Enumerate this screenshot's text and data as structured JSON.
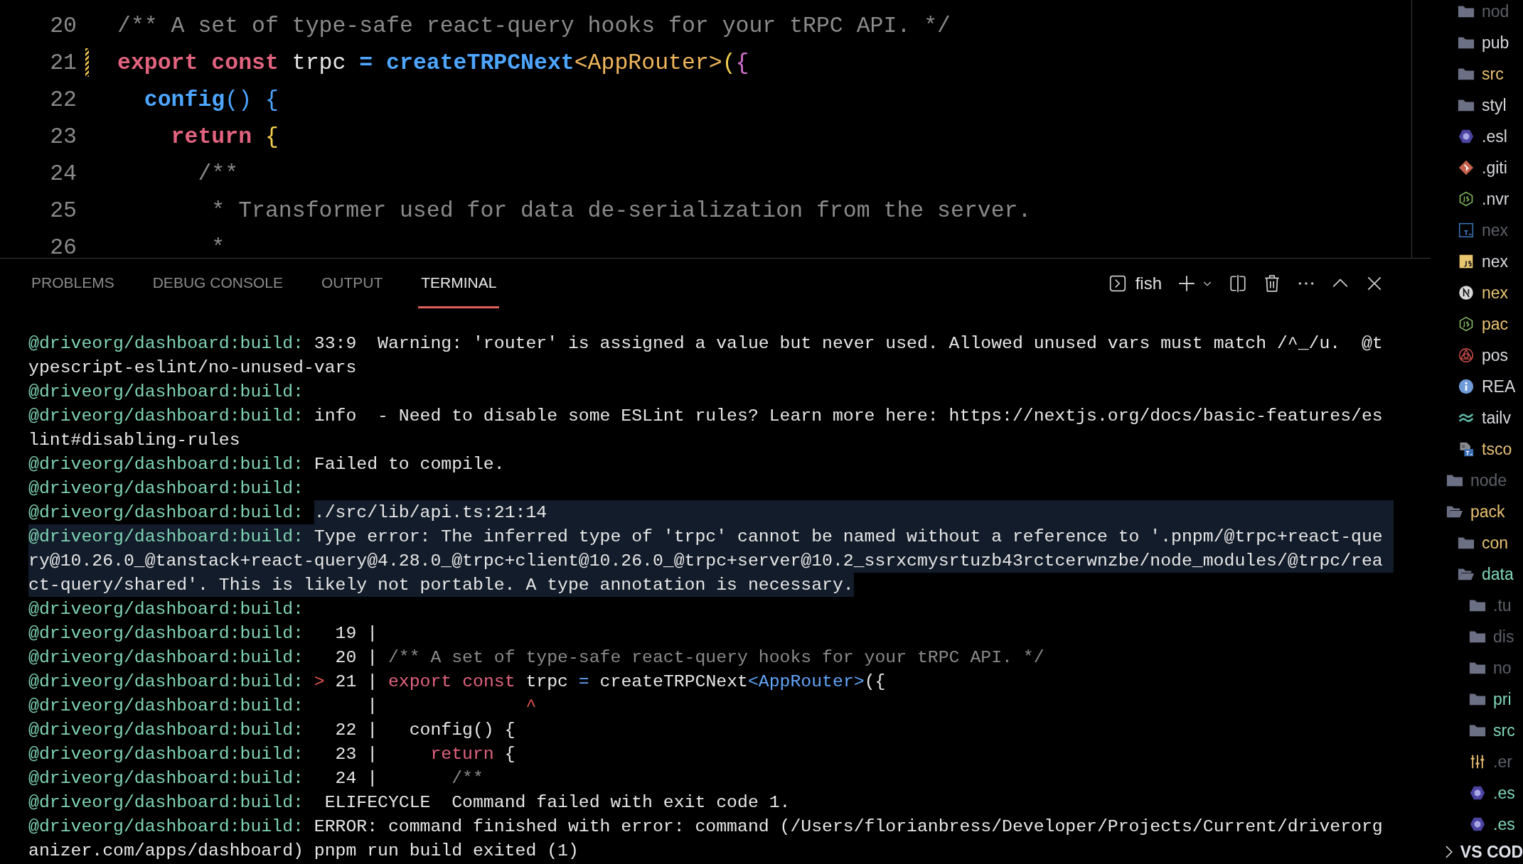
{
  "editor": {
    "lines": [
      {
        "number": "20",
        "modified": false,
        "tokens": [
          {
            "text": "/** A set of type-safe react-query hooks for your tRPC API. */",
            "kind": "comment"
          }
        ]
      },
      {
        "number": "21",
        "modified": true,
        "tokens": [
          {
            "text": "export const",
            "kind": "keyword"
          },
          {
            "text": " trpc ",
            "kind": "plain"
          },
          {
            "text": "=",
            "kind": "function"
          },
          {
            "text": " createTRPCNext",
            "kind": "function"
          },
          {
            "text": "<AppRouter>",
            "kind": "type"
          },
          {
            "text": "(",
            "kind": "bracket"
          },
          {
            "text": "{",
            "kind": "bracket2"
          }
        ]
      },
      {
        "number": "22",
        "modified": false,
        "tokens": [
          {
            "text": "  config",
            "kind": "function"
          },
          {
            "text": "() {",
            "kind": "bracket3"
          }
        ]
      },
      {
        "number": "23",
        "modified": false,
        "tokens": [
          {
            "text": "    return",
            "kind": "keyword"
          },
          {
            "text": " {",
            "kind": "bracket"
          }
        ]
      },
      {
        "number": "24",
        "modified": false,
        "tokens": [
          {
            "text": "      /**",
            "kind": "comment"
          }
        ]
      },
      {
        "number": "25",
        "modified": false,
        "tokens": [
          {
            "text": "       * Transformer used for data de-serialization from the server.",
            "kind": "comment"
          }
        ]
      },
      {
        "number": "26",
        "modified": false,
        "tokens": [
          {
            "text": "       *",
            "kind": "comment"
          }
        ]
      }
    ]
  },
  "panel": {
    "tabs": [
      {
        "label": "PROBLEMS",
        "selected": false
      },
      {
        "label": "DEBUG CONSOLE",
        "selected": false
      },
      {
        "label": "OUTPUT",
        "selected": false
      },
      {
        "label": "TERMINAL",
        "selected": true
      }
    ],
    "shell": "fish",
    "rows": [
      {
        "prefix": "@driveorg/dashboard:build:",
        "selected": false,
        "segments": [
          {
            "text": "33:9  Warning: 'router' is assigned a value but never used. Allowed unused vars must match /^_/u.  @t",
            "kind": "plain"
          }
        ]
      },
      {
        "selected": false,
        "segments": [
          {
            "text": "ypescript-eslint/no-unused-vars",
            "kind": "plain"
          }
        ]
      },
      {
        "prefix": "@driveorg/dashboard:build:",
        "selected": false
      },
      {
        "prefix": "@driveorg/dashboard:build:",
        "selected": false,
        "segments": [
          {
            "text": "info  - Need to disable some ESLint rules? Learn more here: https://nextjs.org/docs/basic-features/es",
            "kind": "plain"
          }
        ]
      },
      {
        "selected": false,
        "segments": [
          {
            "text": "lint#disabling-rules",
            "kind": "plain"
          }
        ]
      },
      {
        "prefix": "@driveorg/dashboard:build:",
        "selected": false,
        "segments": [
          {
            "text": "Failed to compile.",
            "kind": "plain"
          }
        ]
      },
      {
        "prefix": "@driveorg/dashboard:build:",
        "selected": false
      },
      {
        "prefix": "@driveorg/dashboard:build:",
        "selected": true,
        "segments": [
          {
            "text": "./src/lib/api.ts:21:14",
            "kind": "plain"
          }
        ]
      },
      {
        "prefix": "@driveorg/dashboard:build:",
        "selected": true,
        "segments": [
          {
            "text": "Type error: The inferred type of 'trpc' cannot be named without a reference to '.pnpm/@trpc+react-que",
            "kind": "plain"
          }
        ]
      },
      {
        "selected": true,
        "segments": [
          {
            "text": "ry@10.26.0_@tanstack+react-query@4.28.0_@trpc+client@10.26.0_@trpc+server@10.2_ssrxcmysrtuzb43rctcerwnzbe/node_modules/@trpc/rea",
            "kind": "plain"
          }
        ]
      },
      {
        "selected": true,
        "segments": [
          {
            "text": "ct-query/shared'. This is likely not portable. A type annotation is necessary.",
            "kind": "plain"
          }
        ]
      },
      {
        "prefix": "@driveorg/dashboard:build:",
        "selected": false
      },
      {
        "prefix": "@driveorg/dashboard:build:",
        "selected": false,
        "segments": [
          {
            "text": "  19 |",
            "kind": "plain"
          }
        ]
      },
      {
        "prefix": "@driveorg/dashboard:build:",
        "selected": false,
        "segments": [
          {
            "text": "  20 | ",
            "kind": "plain"
          },
          {
            "text": "/** A set of type-safe react-query hooks for your tRPC API. */",
            "kind": "comment"
          }
        ]
      },
      {
        "prefix": "@driveorg/dashboard:build:",
        "selected": false,
        "segments": [
          {
            "text": ">",
            "kind": "marker"
          },
          {
            "text": " 21 | ",
            "kind": "plain"
          },
          {
            "text": "export const",
            "kind": "keyword"
          },
          {
            "text": " trpc ",
            "kind": "plain"
          },
          {
            "text": "=",
            "kind": "operator"
          },
          {
            "text": " createTRPCNext",
            "kind": "plain"
          },
          {
            "text": "<AppRouter>",
            "kind": "operator"
          },
          {
            "text": "({",
            "kind": "plain"
          }
        ]
      },
      {
        "prefix": "@driveorg/dashboard:build:",
        "selected": false,
        "segments": [
          {
            "text": "     |              ",
            "kind": "plain"
          },
          {
            "text": "^",
            "kind": "marker"
          }
        ]
      },
      {
        "prefix": "@driveorg/dashboard:build:",
        "selected": false,
        "segments": [
          {
            "text": "  22 |   config() {",
            "kind": "plain"
          }
        ]
      },
      {
        "prefix": "@driveorg/dashboard:build:",
        "selected": false,
        "segments": [
          {
            "text": "  23 |     ",
            "kind": "plain"
          },
          {
            "text": "return",
            "kind": "keyword"
          },
          {
            "text": " {",
            "kind": "plain"
          }
        ]
      },
      {
        "prefix": "@driveorg/dashboard:build:",
        "selected": false,
        "segments": [
          {
            "text": "  24 |       ",
            "kind": "plain"
          },
          {
            "text": "/**",
            "kind": "comment"
          }
        ]
      },
      {
        "prefix": "@driveorg/dashboard:build:",
        "selected": false,
        "segments": [
          {
            "text": " ELIFECYCLE  Command failed with exit code 1.",
            "kind": "plain"
          }
        ]
      },
      {
        "prefix": "@driveorg/dashboard:build:",
        "selected": false,
        "segments": [
          {
            "text": "ERROR: command finished with error: command (/Users/florianbress/Developer/Projects/Current/driverorg",
            "kind": "plain"
          }
        ]
      },
      {
        "selected": false,
        "segments": [
          {
            "text": "anizer.com/apps/dashboard) pnpm run build exited (1)",
            "kind": "plain"
          }
        ]
      }
    ]
  },
  "explorer": {
    "scrolled_items": [
      {
        "label": "nod",
        "kind": "folder",
        "expanded": false,
        "color": "#5d6068"
      },
      {
        "label": "pub",
        "kind": "folder",
        "expanded": false,
        "color": "#d8d9de"
      },
      {
        "label": "src",
        "kind": "folder",
        "expanded": false,
        "color": "#e8c173"
      },
      {
        "label": "styl",
        "kind": "folder",
        "expanded": false,
        "color": "#d8d9de"
      },
      {
        "label": ".esl",
        "kind": "eslint",
        "color": "#d8d9de"
      },
      {
        "label": ".giti",
        "kind": "git",
        "color": "#d8d9de"
      },
      {
        "label": ".nvr",
        "kind": "node",
        "color": "#d8d9de"
      },
      {
        "label": "nex",
        "kind": "ts",
        "color": "#5d6068"
      },
      {
        "label": "nex",
        "kind": "js",
        "color": "#d8d9de"
      },
      {
        "label": "nex",
        "kind": "next",
        "color": "#e8c173"
      },
      {
        "label": "pac",
        "kind": "node",
        "color": "#e8c173"
      },
      {
        "label": "pos",
        "kind": "postcss",
        "color": "#d8d9de"
      },
      {
        "label": "REA",
        "kind": "info",
        "color": "#d8d9de"
      },
      {
        "label": "tailv",
        "kind": "tailwind",
        "color": "#d8d9de"
      },
      {
        "label": "tsco",
        "kind": "tsconfig",
        "color": "#e8c173"
      }
    ],
    "items": [
      {
        "label": "node",
        "kind": "folder",
        "expanded": false,
        "color": "#5d6068"
      },
      {
        "label": "pack",
        "kind": "folder",
        "expanded": true,
        "color": "#e8c173",
        "children": [
          {
            "label": "con",
            "kind": "folder",
            "expanded": false,
            "color": "#e8c173"
          },
          {
            "label": "data",
            "kind": "folder",
            "expanded": true,
            "color": "#7fd8bb",
            "children": [
              {
                "label": ".tu",
                "kind": "folder",
                "expanded": false,
                "color": "#5d6068"
              },
              {
                "label": "dis",
                "kind": "folder",
                "expanded": false,
                "color": "#5d6068"
              },
              {
                "label": "no",
                "kind": "folder",
                "expanded": false,
                "color": "#5d6068"
              },
              {
                "label": "pri",
                "kind": "folder",
                "expanded": false,
                "color": "#7fd8bb"
              },
              {
                "label": "src",
                "kind": "folder",
                "expanded": false,
                "color": "#7fd8bb"
              },
              {
                "label": ".er",
                "kind": "env",
                "color": "#5d6068"
              },
              {
                "label": ".es",
                "kind": "eslint",
                "color": "#7fd8bb"
              },
              {
                "label": ".es",
                "kind": "eslint",
                "color": "#7fd8bb"
              }
            ]
          }
        ]
      }
    ],
    "section": {
      "label": "VS COD",
      "expanded": false
    }
  }
}
